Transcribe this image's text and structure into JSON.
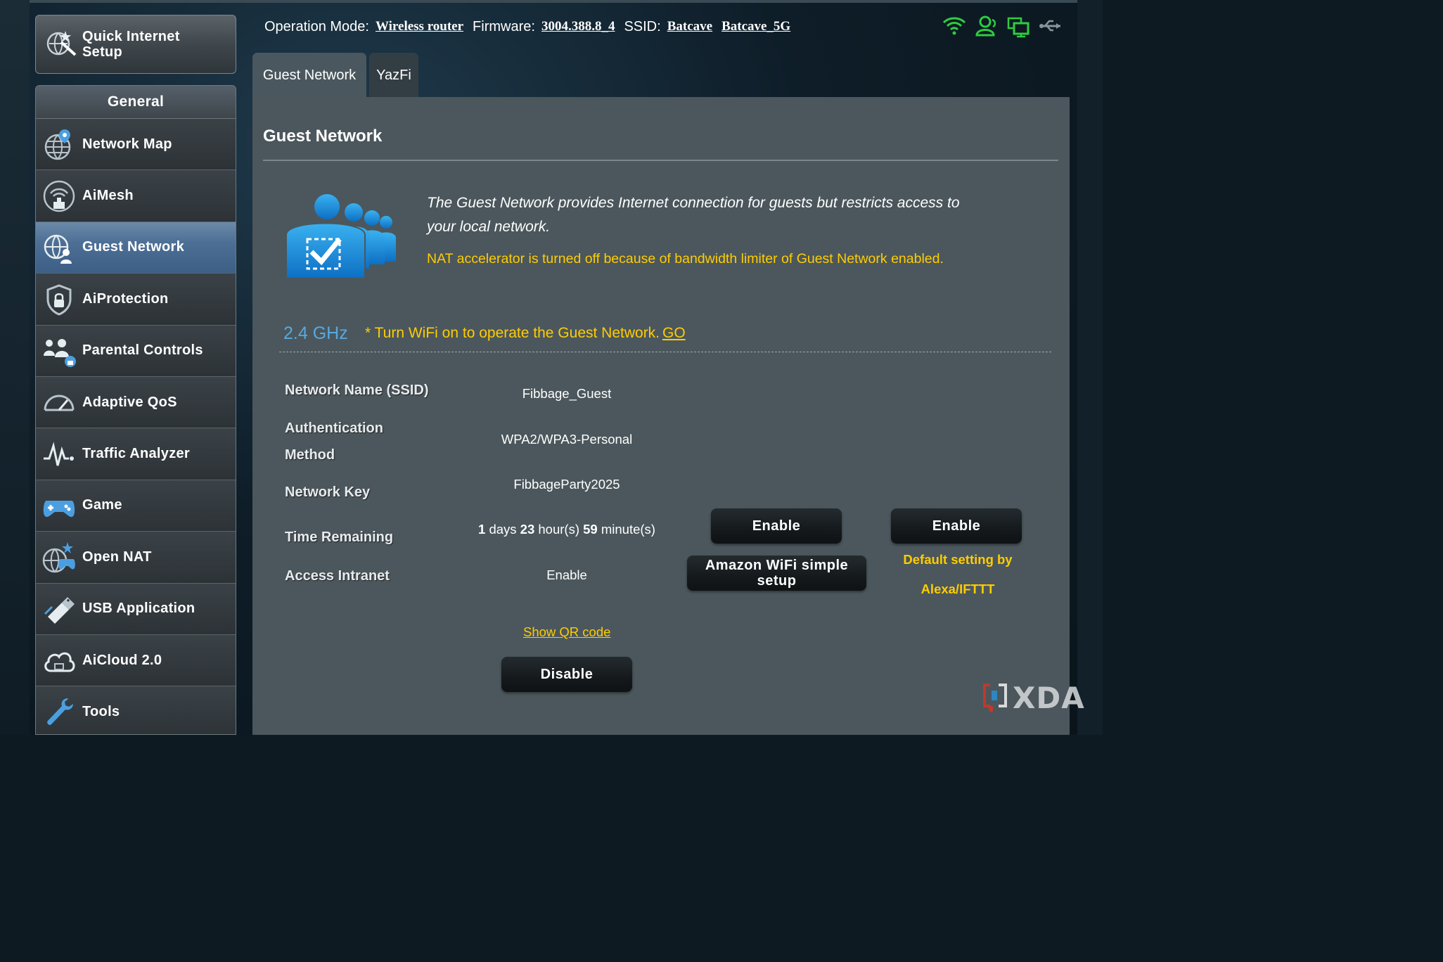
{
  "sidebar": {
    "quick_setup": "Quick Internet Setup",
    "quick_setup_line1": "Quick Internet",
    "quick_setup_line2": "Setup",
    "section_title": "General",
    "items": [
      {
        "label": "Network Map",
        "icon": "globe-pin-icon"
      },
      {
        "label": "AiMesh",
        "icon": "mesh-router-icon"
      },
      {
        "label": "Guest Network",
        "icon": "guest-globe-icon",
        "active": true
      },
      {
        "label": "AiProtection",
        "icon": "shield-lock-icon"
      },
      {
        "label": "Parental Controls",
        "icon": "family-lock-icon"
      },
      {
        "label": "Adaptive QoS",
        "icon": "speedometer-icon"
      },
      {
        "label": "Traffic Analyzer",
        "icon": "pulse-icon"
      },
      {
        "label": "Game",
        "icon": "gamepad-icon"
      },
      {
        "label": "Open NAT",
        "icon": "globe-controller-icon"
      },
      {
        "label": "USB Application",
        "icon": "usb-stick-icon"
      },
      {
        "label": "AiCloud 2.0",
        "icon": "cloud-icon"
      },
      {
        "label": "Tools",
        "icon": "wrench-icon"
      }
    ]
  },
  "header": {
    "operation_mode_label": "Operation Mode:",
    "operation_mode_value": "Wireless router",
    "firmware_label": "Firmware:",
    "firmware_value": "3004.388.8_4",
    "ssid_label": "SSID:",
    "ssid_24": "Batcave",
    "ssid_5": "Batcave_5G",
    "status_icons": [
      "wifi-icon",
      "user-icon",
      "network-icon",
      "usb-icon"
    ]
  },
  "tabs": [
    {
      "label": "Guest Network",
      "active": true
    },
    {
      "label": "YazFi",
      "active": false
    }
  ],
  "panel": {
    "title": "Guest Network",
    "description": "The Guest Network provides Internet connection for guests but restricts access to your local network.",
    "nat_warning": "NAT accelerator is turned off because of bandwidth limiter of Guest Network enabled.",
    "band": "2.4 GHz",
    "notice": "* Turn WiFi on to operate the Guest Network.",
    "notice_link": "GO",
    "fields": {
      "ssid_label": "Network Name (SSID)",
      "ssid_value": "Fibbage_Guest",
      "auth_label_line1": "Authentication",
      "auth_label_line2": "Method",
      "auth_value": "WPA2/WPA3-Personal",
      "key_label": "Network Key",
      "key_value": "FibbageParty2025",
      "time_label": "Time Remaining",
      "time_days": "1",
      "time_days_unit": " days ",
      "time_hours": "23",
      "time_hours_unit": " hour(s) ",
      "time_minutes": "59",
      "time_minutes_unit": " minute(s)",
      "intranet_label": "Access Intranet",
      "intranet_value": "Enable"
    },
    "show_qr": "Show QR code",
    "disable_button": "Disable",
    "enable_button_1": "Enable",
    "enable_button_2": "Enable",
    "amazon_button": "Amazon WiFi simple setup",
    "default_setting_line1": "Default setting by",
    "default_setting_line2": "Alexa/IFTTT"
  },
  "watermark": "XDA",
  "colors": {
    "accent_yellow": "#ffcc00",
    "band_blue": "#57a9e0",
    "active_menu": "#4d6f95",
    "green_icon": "#2ecc40"
  }
}
